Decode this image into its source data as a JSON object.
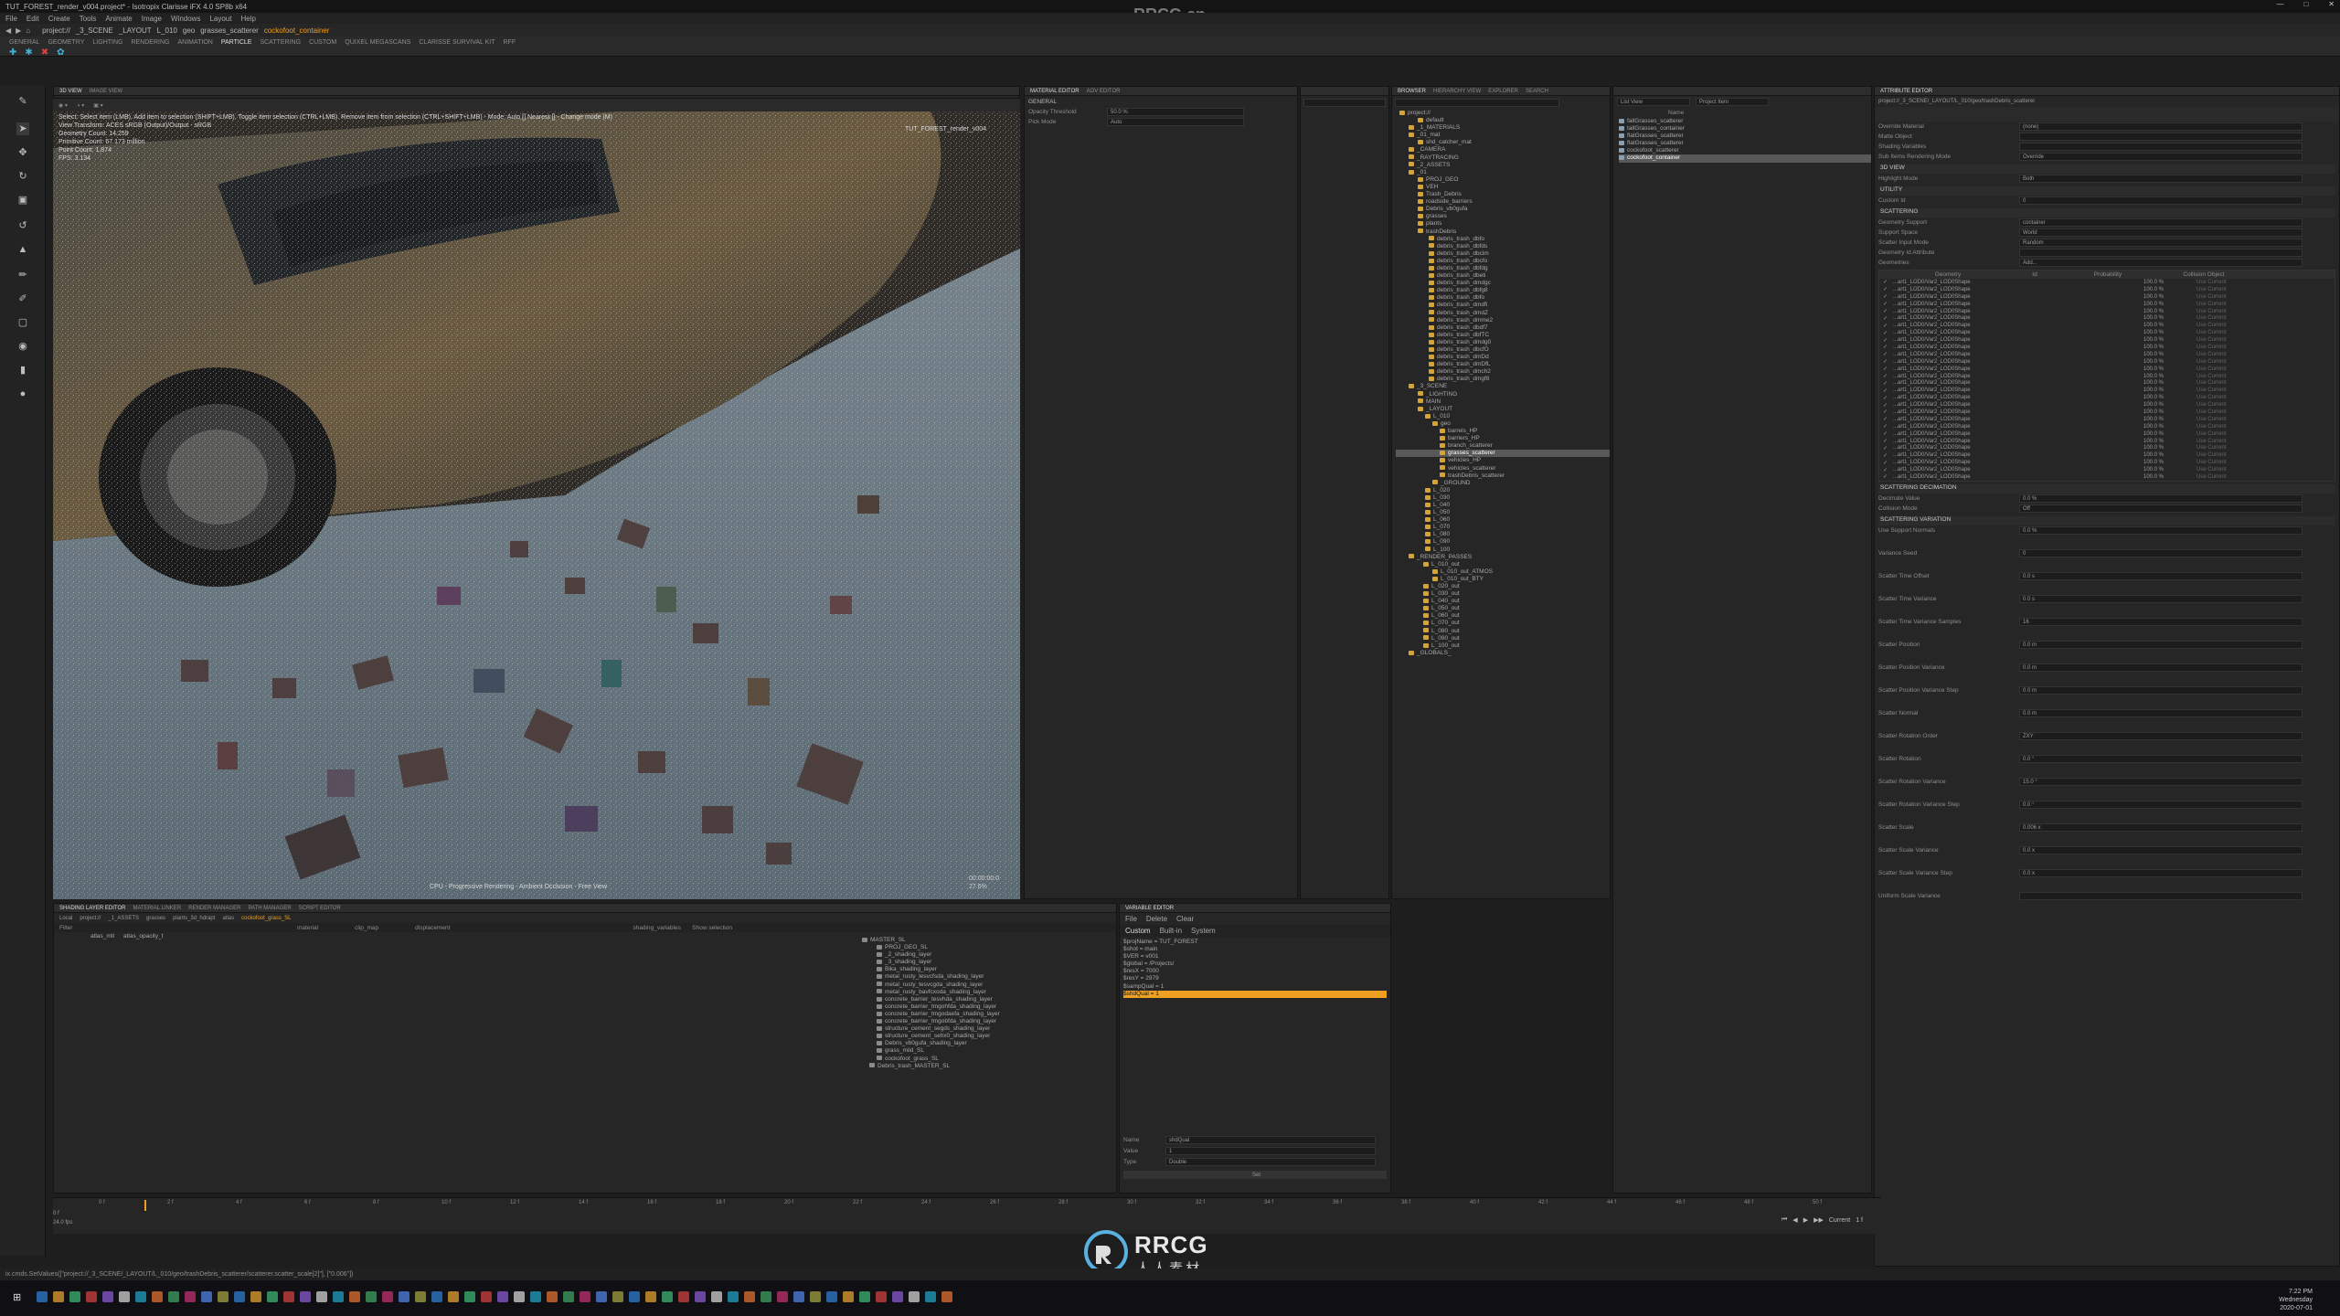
{
  "app": {
    "title": "TUT_FOREST_render_v004.project* - Isotropix Clarisse iFX 4.0 SP8b x64"
  },
  "menu": [
    "File",
    "Edit",
    "Create",
    "Tools",
    "Animate",
    "Image",
    "Windows",
    "Layout",
    "Help"
  ],
  "path_bar": [
    "project://",
    "_3_SCENE",
    "_LAYOUT",
    "L_010",
    "geo",
    "grasses_scatterer",
    "cockofoot_container"
  ],
  "watermark": {
    "top": "RRCG.cn",
    "logo_en": "RRCG",
    "logo_cn": "人人素材"
  },
  "shelf_tabs": [
    "GENERAL",
    "GEOMETRY",
    "LIGHTING",
    "RENDERING",
    "ANIMATION",
    "PARTICLE",
    "SCATTERING",
    "CUSTOM",
    "QUIXEL MEGASCANS",
    "CLARISSE SURVIVAL KIT",
    "RFF"
  ],
  "shelf_active": "PARTICLE",
  "viewport": {
    "tabs": [
      "3D VIEW",
      "IMAGE VIEW"
    ],
    "info_lines": [
      "Select: Select item (LMB). Add item to selection (SHIFT+LMB). Toggle item selection (CTRL+LMB). Remove item from selection (CTRL+SHIFT+LMB) - Mode: Auto [] Nearest [] - Change mode (M)",
      "View Transform: ACES sRGB (Output)/Output - sRGB",
      "Geometry Count: 14,259",
      "Primitive Count: 67.173 million",
      "Point Count: 1,874",
      "FPS: 3.134"
    ],
    "title": "TUT_FOREST_render_v004",
    "status": "CPU - Progressive Rendering - Ambient Occlusion - Free View",
    "time": [
      "00:00:00:0",
      "27.6%"
    ]
  },
  "material_editor": {
    "tabs": [
      "MATERIAL EDITOR",
      "AOV EDITOR"
    ],
    "section": "GENERAL",
    "rows": [
      {
        "label": "Opacity Threshold",
        "value": "50.0 %"
      },
      {
        "label": "Pick Mode",
        "value": "Auto"
      }
    ]
  },
  "browser": {
    "tabs": [
      "BROWSER",
      "HIERARCHY VIEW",
      "EXPLORER",
      "SEARCH"
    ],
    "header": "Name",
    "tree": [
      "project://",
      "default",
      "_1_MATERIALS",
      "_01_mat",
      "shd_catcher_mat",
      "_CAMERA",
      "_RAYTRACING",
      "_2_ASSETS",
      "_01",
      "PROJ_GEO",
      "VEH",
      "Trash_Debris",
      "roadside_barriers",
      "Debris_vb0gufa",
      "grasses",
      "plants",
      "trashDebris",
      "debris_trash_dbfo",
      "debris_trash_dbfds",
      "debris_trash_dbcim",
      "debris_trash_dbcfo",
      "debris_trash_dbfdg",
      "debris_trash_dbeti",
      "debris_trash_dmdgc",
      "debris_trash_dbfg8",
      "debris_trash_dbfo",
      "debris_trash_dmdfi",
      "debris_trash_dmdZ",
      "debris_trash_dmme2",
      "debris_trash_dbdf7",
      "debris_trash_dbfTC",
      "debris_trash_dmdg0",
      "debris_trash_dbcfO",
      "debris_trash_dmDd",
      "debris_trash_dmDfL",
      "debris_trash_dmch2",
      "debris_trash_dmgf8",
      "_3_SCENE",
      "_LIGHTING",
      "MAIN",
      "_LAYOUT",
      "L_010",
      "geo",
      "barrels_HP",
      "barriers_HP",
      "branch_scatterer",
      "grasses_scatterer",
      "vehicles_HP",
      "vehicles_scatterer",
      "trashDebris_scatterer",
      "_GROUND",
      "L_020",
      "L_030",
      "L_040",
      "L_050",
      "L_060",
      "L_070",
      "L_080",
      "L_090",
      "L_100",
      "_RENDER_PASSES",
      "L_010_out",
      "L_010_out_ATMOS",
      "L_010_out_BTY",
      "L_020_out",
      "L_030_out",
      "L_040_out",
      "L_050_out",
      "L_060_out",
      "L_070_out",
      "L_080_out",
      "L_090_out",
      "L_100_out",
      "_GLOBALS_"
    ]
  },
  "list_view": {
    "tabs": [
      "List View",
      "Project Item"
    ],
    "header": "Name",
    "items": [
      "fallGrasses_scatterer",
      "tallGrasses_container",
      "flatGrasses_scatterer",
      "flatGrasses_scatterer",
      "cockofoot_scatterer",
      "cockofoot_container"
    ]
  },
  "attribute_editor": {
    "title": "ATTRIBUTE EDITOR",
    "path": "project://_3_SCENE/_LAYOUT/L_010/geo/trashDebris_scatterer",
    "rows": [
      {
        "label": "Override Material",
        "value": "(none)"
      },
      {
        "label": "Matte Object",
        "value": ""
      },
      {
        "label": "Shading Variables",
        "value": ""
      },
      {
        "label": "Sub Items Rendering Mode",
        "value": "Override"
      },
      {
        "section": "3D VIEW"
      },
      {
        "label": "Highlight Mode",
        "value": "Both"
      },
      {
        "section": "UTILITY"
      },
      {
        "label": "Custom Id",
        "value": "0"
      },
      {
        "section": "SCATTERING"
      },
      {
        "label": "Geometry Support",
        "value": "container"
      },
      {
        "label": "Support Space",
        "value": "World"
      },
      {
        "label": "Scatter Input Mode",
        "value": "Random"
      },
      {
        "label": "Geometry Id Attribute",
        "value": ""
      },
      {
        "label": "Geometries",
        "value": "Add..."
      }
    ],
    "geo_table": {
      "headers": [
        "Geometry",
        "Id",
        "Probability",
        "Collision Object"
      ],
      "rows_label": "...art1_LOD0/Var2_LOD0Shape",
      "prob": "100.0 %",
      "use": "Use Current",
      "count": 28
    },
    "decimation": {
      "section": "SCATTERING DECIMATION",
      "rows": [
        {
          "label": "Decimate Value",
          "value": "0.0 %"
        },
        {
          "label": "Collision Mode",
          "value": "Off"
        }
      ]
    },
    "variation": {
      "section": "SCATTERING VARIATION",
      "rows": [
        {
          "label": "Use Support Normals",
          "value": "0.0 %"
        },
        {
          "label": "Variance Seed",
          "value": "0"
        },
        {
          "label": "Scatter Time Offset",
          "value": "0.0 s"
        },
        {
          "label": "Scatter Time Variance",
          "value": "0.0 s"
        },
        {
          "label": "Scatter Time Variance Samples",
          "value": "16"
        },
        {
          "label": "Scatter Position",
          "value": "0.0 m"
        },
        {
          "label": "Scatter Position Variance",
          "value": "0.0 m"
        },
        {
          "label": "Scatter Position Variance Step",
          "value": "0.0 m"
        },
        {
          "label": "Scatter Normal",
          "value": "0.0 m"
        },
        {
          "label": "Scatter Rotation Order",
          "value": "ZXY"
        },
        {
          "label": "Scatter Rotation",
          "value": "0.0 °"
        },
        {
          "label": "Scatter Rotation Variance",
          "value": "15.0 °"
        },
        {
          "label": "Scatter Rotation Variance Step",
          "value": "0.0 °"
        },
        {
          "label": "Scatter Scale",
          "value": "0.006 x"
        },
        {
          "label": "Scatter Scale Variance",
          "value": "0.0 x"
        },
        {
          "label": "Scatter Scale Variance Step",
          "value": "0.0 x"
        },
        {
          "label": "Uniform Scale Variance",
          "value": ""
        }
      ]
    }
  },
  "shading_editor": {
    "tabs": [
      "SHADING LAYER EDITOR",
      "MATERIAL LINKER",
      "RENDER MANAGER",
      "PATH MANAGER",
      "SCRIPT EDITOR"
    ],
    "path": [
      "Local",
      "project://",
      "_1_ASSETS",
      "grasses",
      "plants_3d_hdrapt",
      "atlas",
      "cockofoot_grass_SL"
    ],
    "filter": "Filter",
    "columns": [
      "material",
      "clip_map",
      "displacement",
      "shading_variables"
    ],
    "row": [
      "atlas_mtl",
      "atlas_opacity_t"
    ],
    "show_selection": "Show selection",
    "tree": [
      "MASTER_SL",
      "PROJ_GEO_SL",
      "_2_shading_layer",
      "_3_shading_layer",
      "Bika_shading_layer",
      "metal_rusty_lesvcfsda_shading_layer",
      "metal_rusty_tesvcgda_shading_layer",
      "metal_rusty_bavfcxoda_shading_layer",
      "concrete_barrier_tesvhda_shading_layer",
      "concrete_barrier_tmgohfda_shading_layer",
      "concrete_barrier_tmgodaefa_shading_layer",
      "concrete_barrier_tmgobfda_shading_layer",
      "structure_cement_segds_shading_layer",
      "structure_cement_sehx0_shading_layer",
      "Debris_vb0gufa_shading_layer",
      "grass_mild_SL",
      "cockofoot_grass_SL",
      "Debris_trash_MASTER_SL"
    ]
  },
  "variable_editor": {
    "title": "VARIABLE EDITOR",
    "menu": [
      "File",
      "Delete",
      "Clear"
    ],
    "tabs": [
      "Custom",
      "Built-in",
      "System"
    ],
    "vars": [
      "$projName = TUT_FOREST",
      "$shot = main",
      "$VER = v001",
      "$global = /Projects/",
      "$resX = 7000",
      "$resY = 2979",
      "$sampQual = 1",
      "$shdQual = 1"
    ],
    "selected": "$shdQual = 1",
    "fields": [
      {
        "label": "Name",
        "value": "shdQual"
      },
      {
        "label": "Value",
        "value": "1"
      },
      {
        "label": "Type",
        "value": "Double"
      }
    ],
    "set_button": "Set"
  },
  "timeline": {
    "start": "0 f",
    "start2": "24.0 fps",
    "ticks": [
      "0 f",
      "2 f",
      "4 f",
      "6 f",
      "8 f",
      "10 f",
      "12 f",
      "14 f",
      "16 f",
      "18 f",
      "20 f",
      "22 f",
      "24 f",
      "26 f",
      "28 f",
      "30 f",
      "32 f",
      "34 f",
      "36 f",
      "38 f",
      "40 f",
      "42 f",
      "44 f",
      "46 f",
      "48 f",
      "50 f"
    ],
    "current_label": "Current",
    "current": "1 f",
    "end": "50 f"
  },
  "status": "ix.cmds.SetValues([\"project://_3_SCENE/_LAYOUT/L_010/geo/trashDebris_scatterer/scatterer.scatter_scale[2]\"], [\"0.006\"])",
  "clock": {
    "time": "7:22 PM",
    "day": "Wednesday",
    "date": "2020-07-01"
  },
  "colors": {
    "accent_orange": "#f0a020",
    "accent_blue": "#3fb3d8",
    "bg": "#1e1e1e"
  }
}
